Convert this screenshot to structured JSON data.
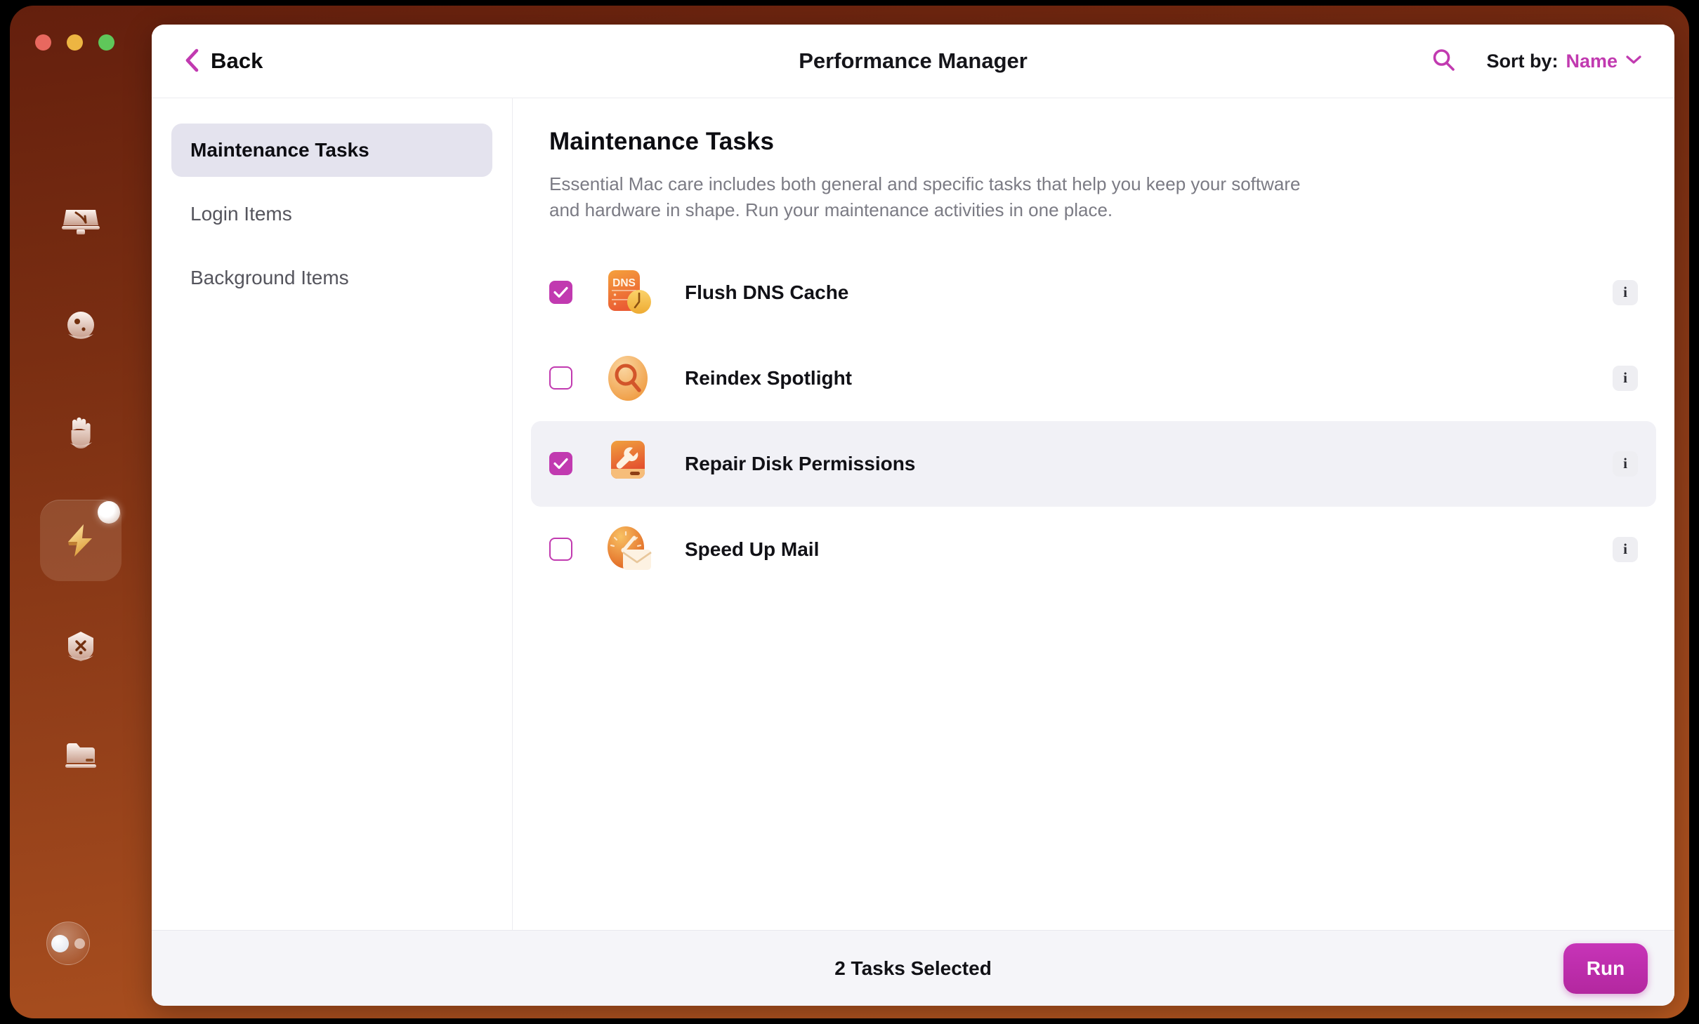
{
  "window": {
    "title": "Performance Manager",
    "back_label": "Back",
    "traffic_lights": [
      "close",
      "minimize",
      "maximize"
    ]
  },
  "header": {
    "search_icon": "search-icon",
    "sort_label": "Sort by:",
    "sort_value": "Name",
    "chevron_icon": "chevron-down-icon"
  },
  "sidebar": {
    "items": [
      {
        "label": "Maintenance Tasks",
        "selected": true
      },
      {
        "label": "Login Items",
        "selected": false
      },
      {
        "label": "Background Items",
        "selected": false
      }
    ]
  },
  "main": {
    "title": "Maintenance Tasks",
    "description": "Essential Mac care includes both general and specific tasks that help you keep your software and hardware in shape. Run your maintenance activities in one place.",
    "tasks": [
      {
        "label": "Flush DNS Cache",
        "checked": true,
        "hovered": false,
        "icon": "dns-clock-icon",
        "info_label": "i"
      },
      {
        "label": "Reindex Spotlight",
        "checked": false,
        "hovered": false,
        "icon": "magnifier-icon",
        "info_label": "i"
      },
      {
        "label": "Repair Disk Permissions",
        "checked": true,
        "hovered": true,
        "icon": "disk-wrench-icon",
        "info_label": "i"
      },
      {
        "label": "Speed Up Mail",
        "checked": false,
        "hovered": false,
        "icon": "speedometer-mail-icon",
        "info_label": "i"
      }
    ]
  },
  "footer": {
    "status": "2 Tasks Selected",
    "run_label": "Run"
  },
  "dock": {
    "items": [
      {
        "icon": "desktop-icon",
        "active": false,
        "badge": false
      },
      {
        "icon": "face-icon",
        "active": false,
        "badge": false
      },
      {
        "icon": "hand-icon",
        "active": false,
        "badge": false
      },
      {
        "icon": "lightning-icon",
        "active": true,
        "badge": true
      },
      {
        "icon": "shield-tools-icon",
        "active": false,
        "badge": false
      },
      {
        "icon": "folder-icon",
        "active": false,
        "badge": false
      }
    ],
    "assistant_icon": "assistant-icon"
  },
  "colors": {
    "accent": "#c13ab0",
    "run_button": "#b3279f",
    "desktop_top": "#641f0d",
    "desktop_bottom": "#b4571f",
    "selected_nav": "#e4e3ee",
    "hover_row": "#f1f1f6"
  }
}
